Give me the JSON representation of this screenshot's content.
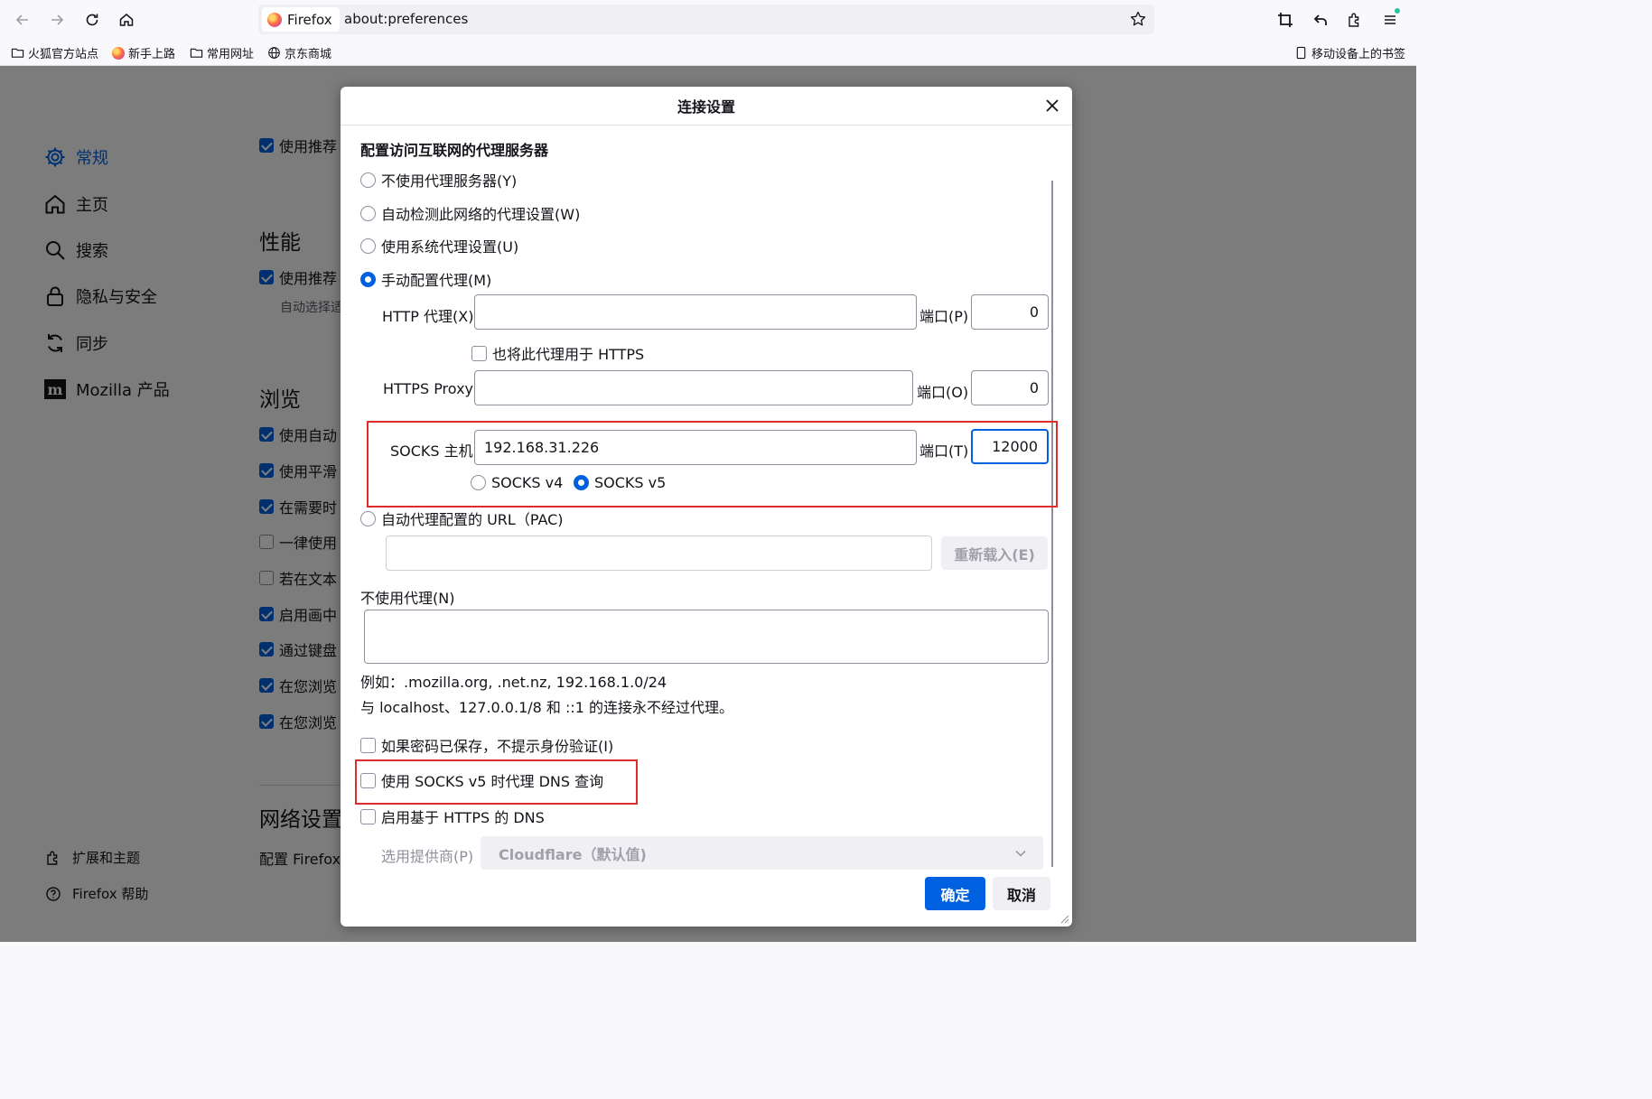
{
  "browser": {
    "identity_label": "Firefox",
    "url": "about:preferences",
    "bookmarks": [
      {
        "label": "火狐官方站点",
        "icon": "folder-icon"
      },
      {
        "label": "新手上路",
        "icon": "firefox-icon"
      },
      {
        "label": "常用网址",
        "icon": "folder-icon"
      },
      {
        "label": "京东商城",
        "icon": "globe-icon"
      }
    ],
    "mobile_bookmarks": "移动设备上的书签"
  },
  "sidebar": {
    "items": [
      {
        "label": "常规",
        "icon": "gear-icon",
        "active": true
      },
      {
        "label": "主页",
        "icon": "home-icon"
      },
      {
        "label": "搜索",
        "icon": "search-icon"
      },
      {
        "label": "隐私与安全",
        "icon": "lock-icon"
      },
      {
        "label": "同步",
        "icon": "sync-icon"
      },
      {
        "label": "Mozilla 产品",
        "icon": "mozilla-icon"
      }
    ],
    "footer": [
      {
        "label": "扩展和主题",
        "icon": "puzzle-icon"
      },
      {
        "label": "Firefox 帮助",
        "icon": "help-icon"
      }
    ]
  },
  "prefs": {
    "top_partial": "使用推荐",
    "performance_title": "性能",
    "performance_row": "使用推荐",
    "performance_sub": "自动选择适",
    "browsing_title": "浏览",
    "browsing_rows": [
      {
        "label": "使用自动",
        "checked": true
      },
      {
        "label": "使用平滑",
        "checked": true
      },
      {
        "label": "在需要时",
        "checked": true
      },
      {
        "label": "一律使用",
        "checked": false
      },
      {
        "label": "若在文本",
        "checked": false
      },
      {
        "label": "启用画中",
        "checked": true
      },
      {
        "label": "通过键盘",
        "checked": true
      },
      {
        "label": "在您浏览",
        "checked": true
      },
      {
        "label": "在您浏览",
        "checked": true
      }
    ],
    "network_title": "网络设置",
    "network_row": "配置 Firefox"
  },
  "dialog": {
    "title": "连接设置",
    "heading": "配置访问互联网的代理服务器",
    "proxy_options": {
      "none": "不使用代理服务器(Y)",
      "auto_detect": "自动检测此网络的代理设置(W)",
      "system": "使用系统代理设置(U)",
      "manual": "手动配置代理(M)"
    },
    "http_label": "HTTP 代理(X)",
    "http_value": "",
    "http_port_label": "端口(P)",
    "http_port": "0",
    "also_https": "也将此代理用于 HTTPS",
    "https_label": "HTTPS Proxy",
    "https_value": "",
    "https_port_label": "端口(O)",
    "https_port": "0",
    "socks_label": "SOCKS 主机",
    "socks_value": "192.168.31.226",
    "socks_port_label": "端口(T)",
    "socks_port": "12000",
    "socks_v4": "SOCKS v4",
    "socks_v5": "SOCKS v5",
    "pac_label": "自动代理配置的 URL（PAC)",
    "pac_value": "",
    "reload_button": "重新载入(E)",
    "no_proxy_label": "不使用代理(N)",
    "no_proxy_value": "",
    "example_line": "例如：.mozilla.org, .net.nz, 192.168.1.0/24",
    "localhost_line": "与 localhost、127.0.0.1/8 和 ::1 的连接永不经过代理。",
    "no_auth_prompt": "如果密码已保存，不提示身份验证(I)",
    "socks_dns": "使用 SOCKS v5 时代理 DNS 查询",
    "https_dns": "启用基于 HTTPS 的 DNS",
    "provider_label": "选用提供商(P)",
    "provider_value": "Cloudflare（默认值)",
    "ok_button": "确定",
    "cancel_button": "取消"
  }
}
